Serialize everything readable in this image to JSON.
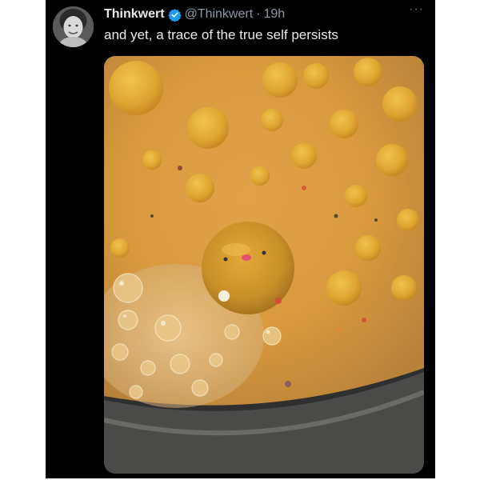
{
  "tweet": {
    "display_name": "Thinkwert",
    "handle": "@Thinkwert",
    "separator": "·",
    "time": "19h",
    "text": "and yet, a trace of the true self persists",
    "more_label": "···",
    "verified": true
  },
  "icons": {
    "avatar": "profile-photo",
    "verified": "verified-badge-icon",
    "more": "more-options-icon"
  },
  "colors": {
    "background": "#000000",
    "text_primary": "#e7e9ea",
    "text_secondary": "#8b98a5",
    "verified_blue": "#1d9bf0"
  },
  "media": {
    "kind": "photo",
    "subject": "broth-with-oil-droplets"
  }
}
